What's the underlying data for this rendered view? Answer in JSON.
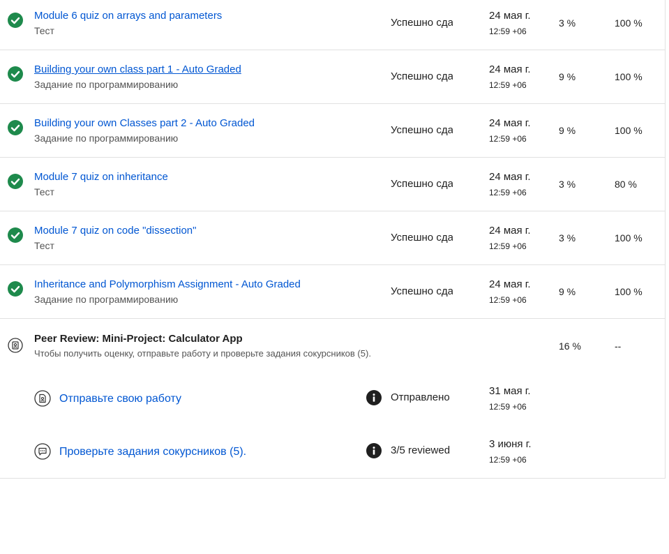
{
  "items": [
    {
      "title": "Module 6 quiz on arrays and parameters",
      "type": "Тест",
      "status": "Успешно сдано",
      "date": "24 мая г.",
      "time": "12:59 +06",
      "weight": "3 %",
      "grade": "100 %"
    },
    {
      "title": "Building your own class part 1 - Auto Graded",
      "type": "Задание по программированию",
      "status": "Успешно сдано",
      "date": "24 мая г.",
      "time": "12:59 +06",
      "weight": "9 %",
      "grade": "100 %"
    },
    {
      "title": "Building your own Classes part 2 - Auto Graded",
      "type": "Задание по программированию",
      "status": "Успешно сдано",
      "date": "24 мая г.",
      "time": "12:59 +06",
      "weight": "9 %",
      "grade": "100 %"
    },
    {
      "title": "Module 7 quiz on inheritance",
      "type": "Тест",
      "status": "Успешно сдано",
      "date": "24 мая г.",
      "time": "12:59 +06",
      "weight": "3 %",
      "grade": "80 %"
    },
    {
      "title": "Module 7 quiz on code \"dissection\"",
      "type": "Тест",
      "status": "Успешно сдано",
      "date": "24 мая г.",
      "time": "12:59 +06",
      "weight": "3 %",
      "grade": "100 %"
    },
    {
      "title": "Inheritance and Polymorphism Assignment - Auto Graded",
      "type": "Задание по программированию",
      "status": "Успешно сдано",
      "date": "24 мая г.",
      "time": "12:59 +06",
      "weight": "9 %",
      "grade": "100 %"
    }
  ],
  "peer_review": {
    "title": "Peer Review: Mini-Project: Calculator App",
    "description": "Чтобы получить оценку, отправьте работу и проверьте задания сокурсников (5).",
    "weight": "16 %",
    "grade": "--",
    "submit": {
      "label": "Отправьте свою работу",
      "status": "Отправлено",
      "date": "31 мая г.",
      "time": "12:59 +06"
    },
    "review": {
      "label": "Проверьте задания сокурсников (5).",
      "status": "3/5 reviewed",
      "date": "3 июня г.",
      "time": "12:59 +06"
    }
  },
  "colors": {
    "link": "#0056d2",
    "success": "#1e8a4c",
    "divider": "#e1e1e1"
  },
  "icons": {
    "completed": "check-circle-icon",
    "peer_review": "peer-review-icon",
    "submit": "submit-assignment-icon",
    "review": "review-chat-icon",
    "info": "info-icon"
  }
}
